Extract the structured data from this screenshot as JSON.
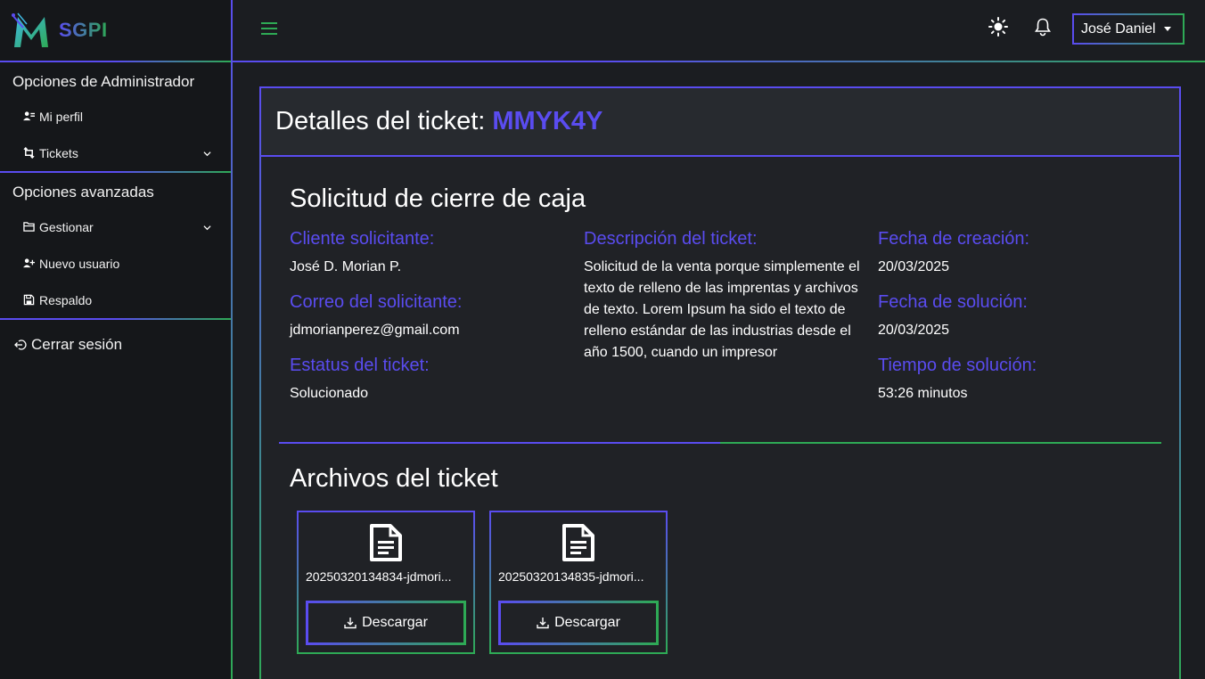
{
  "brand": {
    "name": "SGPI"
  },
  "sidebar": {
    "admin_section": "Opciones de Administrador",
    "admin_items": [
      {
        "label": "Mi perfil",
        "icon": "person-lines-icon"
      },
      {
        "label": "Tickets",
        "icon": "ticket-arrows-icon"
      }
    ],
    "advanced_section": "Opciones avanzadas",
    "advanced_items": [
      {
        "label": "Gestionar",
        "icon": "folder-icon"
      },
      {
        "label": "Nuevo usuario",
        "icon": "person-plus-icon"
      },
      {
        "label": "Respaldo",
        "icon": "save-icon"
      }
    ],
    "logout_label": "Cerrar sesión"
  },
  "header": {
    "user_name": "José Daniel"
  },
  "ticket": {
    "title_prefix": "Detalles del ticket:",
    "code": "MMYK4Y",
    "subject": "Solicitud de cierre de caja",
    "client_label": "Cliente solicitante:",
    "client": "José D. Morian P.",
    "email_label": "Correo del solicitante:",
    "email": "jdmorianperez@gmail.com",
    "status_label": "Estatus del ticket:",
    "status": "Solucionado",
    "description_label": "Descripción del ticket:",
    "description": "Solicitud de la venta porque simplemente el texto de relleno de las imprentas y archivos de texto. Lorem Ipsum ha sido el texto de relleno estándar de las industrias desde el año 1500, cuando un impresor",
    "created_label": "Fecha de creación:",
    "created": "20/03/2025",
    "solved_label": "Fecha de solución:",
    "solved": "20/03/2025",
    "solve_time_label": "Tiempo de solución:",
    "solve_time": "53:26 minutos"
  },
  "files": {
    "title": "Archivos del ticket",
    "items": [
      {
        "name": "20250320134834-jdmori...",
        "button": "Descargar"
      },
      {
        "name": "20250320134835-jdmori...",
        "button": "Descargar"
      }
    ]
  },
  "colors": {
    "accent": "#5a4cf0",
    "secondary": "#2eaa55",
    "background": "#1b1d21"
  }
}
